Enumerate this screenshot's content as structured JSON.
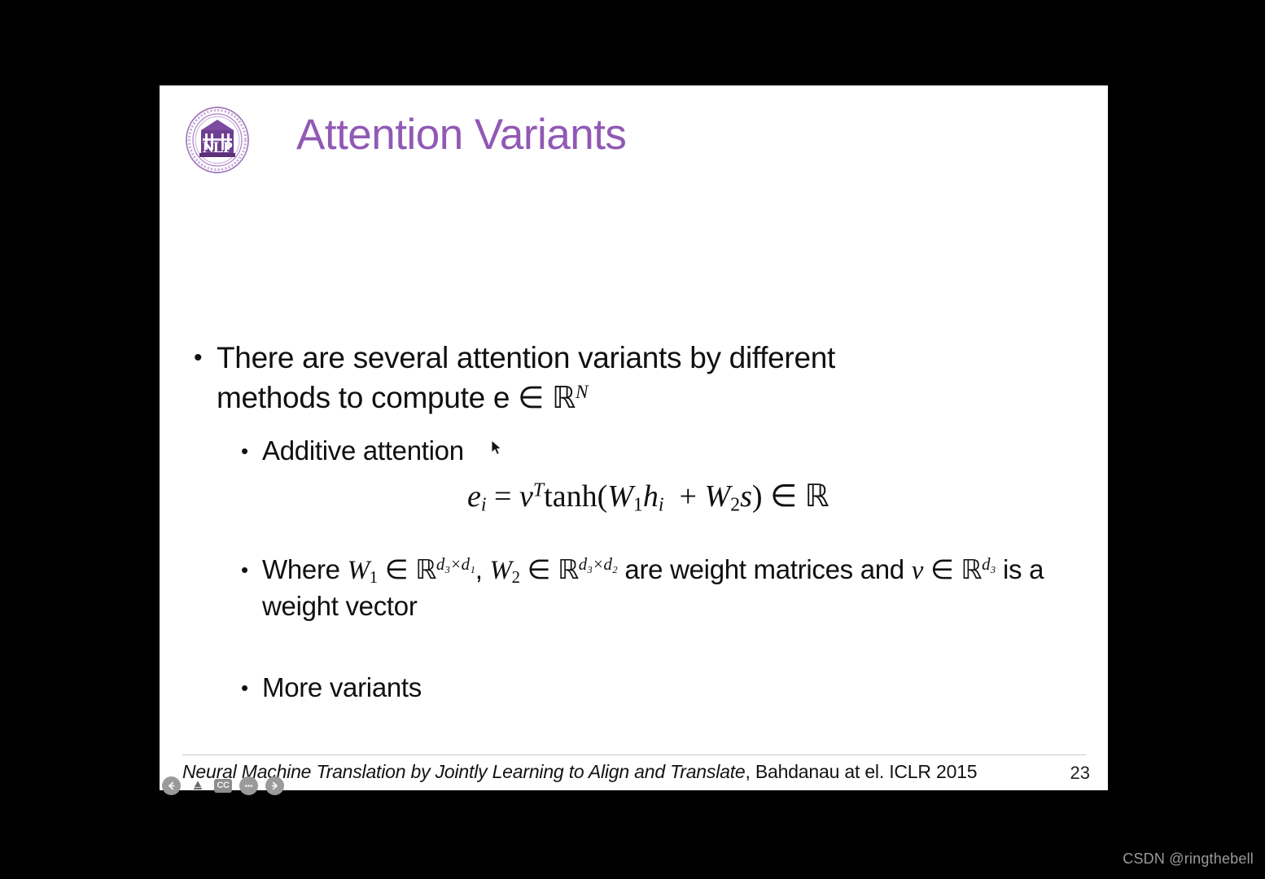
{
  "slide": {
    "title": "Attention Variants",
    "title_color": "#9159b5",
    "logo_label": "NLP",
    "page_number": "23",
    "background": "#ffffff"
  },
  "bullets": {
    "main": {
      "marker": "•",
      "text_line1": "There are several attention variants by different",
      "text_line2_prefix": "methods to compute e ",
      "in_symbol": "∈",
      "set_symbol": "ℝ",
      "set_exponent": "N"
    },
    "additive": {
      "marker": "•",
      "label": "Additive attention"
    },
    "where": {
      "marker": "•",
      "lead": "Where ",
      "W1": "W",
      "W1_sub": "1",
      "in1": "∈",
      "R1": "ℝ",
      "R1_exp": "d₃×d₁",
      "comma": ", ",
      "W2": "W",
      "W2_sub": "2",
      "in2": "∈",
      "R2": "ℝ",
      "R2_exp": "d₃×d₂",
      "tail": " are weight matrices and",
      "line2_v": "v",
      "line2_in": "∈",
      "line2_R": "ℝ",
      "line2_R_exp": "d₃",
      "line2_tail": " is a weight vector"
    },
    "more": {
      "marker": "•",
      "label": "More variants"
    }
  },
  "equation": {
    "lhs_var": "e",
    "lhs_sub": "i",
    "equals": "=",
    "v": "v",
    "v_sup": "T",
    "fn": "tanh(",
    "W1": "W",
    "W1_sub": "1",
    "h": "h",
    "h_sub": "i",
    "plus": "+",
    "W2": "W",
    "W2_sub": "2",
    "s": "s",
    "close": ")",
    "in_symbol": "∈",
    "set_symbol": "ℝ"
  },
  "footer": {
    "citation_italic": "Neural Machine Translation by Jointly Learning to Align and Translate",
    "citation_rest": ", Bahdanau at el.  ICLR 2015"
  },
  "toolbar": {
    "back_label": "←",
    "pen_label": "pen",
    "cc_label": "CC",
    "more_label": "…",
    "forward_label": "→"
  },
  "watermark": {
    "text": "CSDN @ringthebell"
  }
}
